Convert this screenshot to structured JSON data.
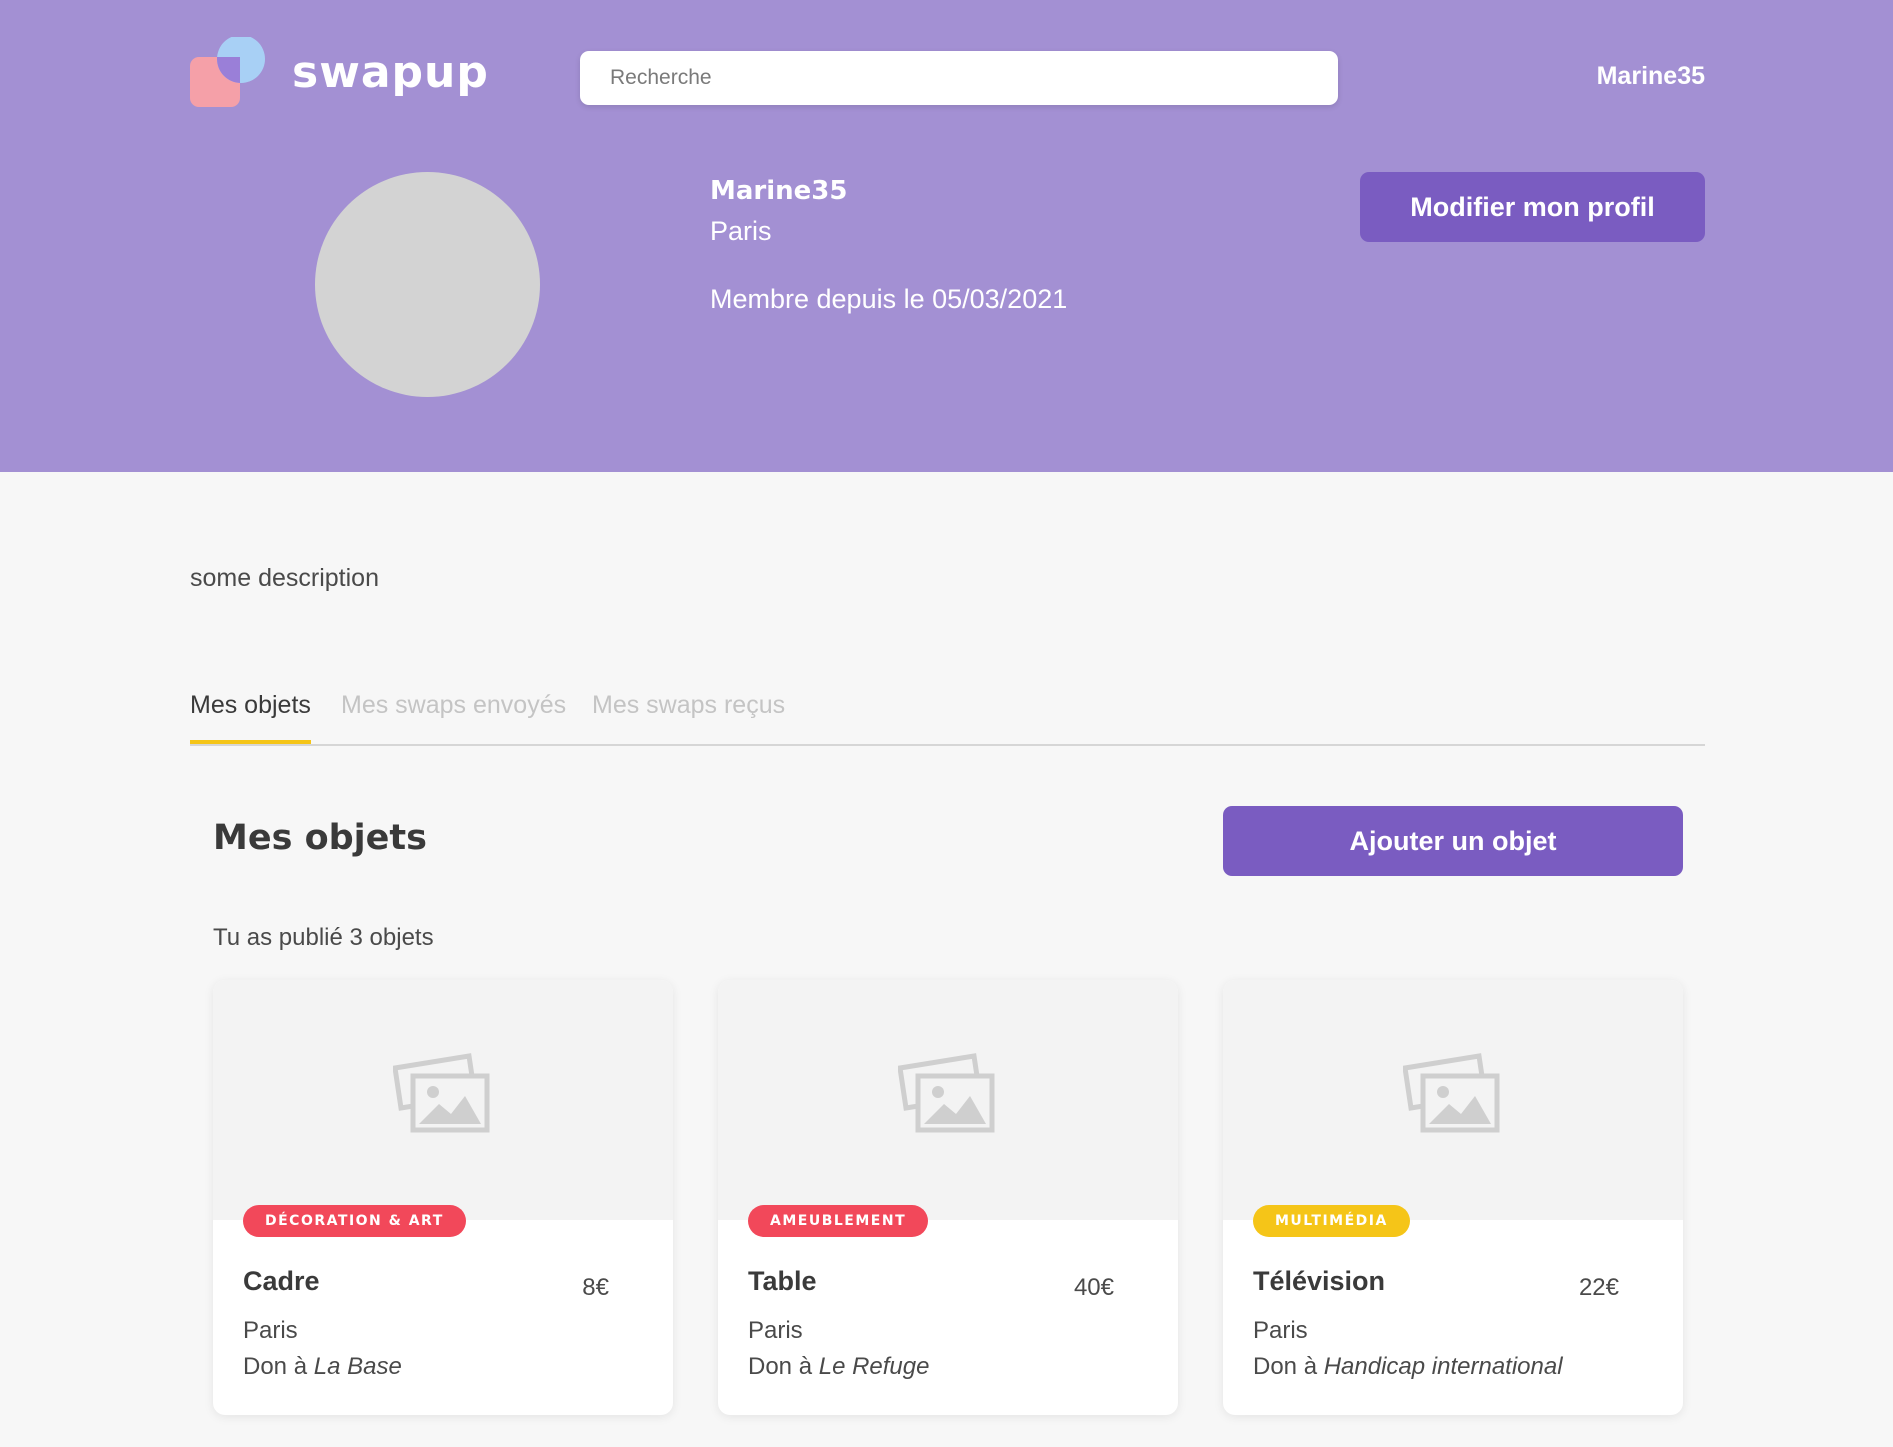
{
  "brand": {
    "name": "swapup"
  },
  "search": {
    "placeholder": "Recherche"
  },
  "nav": {
    "username": "Marine35"
  },
  "profile": {
    "username": "Marine35",
    "city": "Paris",
    "member_since": "Membre depuis le 05/03/2021",
    "edit_label": "Modifier mon profil",
    "description": "some description"
  },
  "tabs": [
    {
      "label": "Mes objets",
      "active": true
    },
    {
      "label": "Mes swaps envoyés",
      "active": false
    },
    {
      "label": "Mes swaps reçus",
      "active": false
    }
  ],
  "objects": {
    "title": "Mes objets",
    "add_label": "Ajouter un objet",
    "count_text": "Tu as publié 3 objets",
    "don_prefix": "Don à",
    "items": [
      {
        "category": "DÉCORATION & ART",
        "category_color": "#f2485a",
        "title": "Cadre",
        "price": "8€",
        "city": "Paris",
        "recipient": "La Base"
      },
      {
        "category": "AMEUBLEMENT",
        "category_color": "#f2485a",
        "title": "Table",
        "price": "40€",
        "city": "Paris",
        "recipient": "Le Refuge"
      },
      {
        "category": "MULTIMÉDIA",
        "category_color": "#f5c518",
        "title": "Télévision",
        "price": "22€",
        "city": "Paris",
        "recipient": "Handicap international"
      }
    ]
  },
  "colors": {
    "header_bg": "#a390d3",
    "primary_button": "#7a5cc1",
    "tab_active_underline": "#f5c518",
    "logo_pink": "#f5a0a8",
    "logo_blue": "#a8d0f5",
    "logo_overlap": "#9a7fd8"
  },
  "icons": [
    "image-placeholder-icon"
  ]
}
